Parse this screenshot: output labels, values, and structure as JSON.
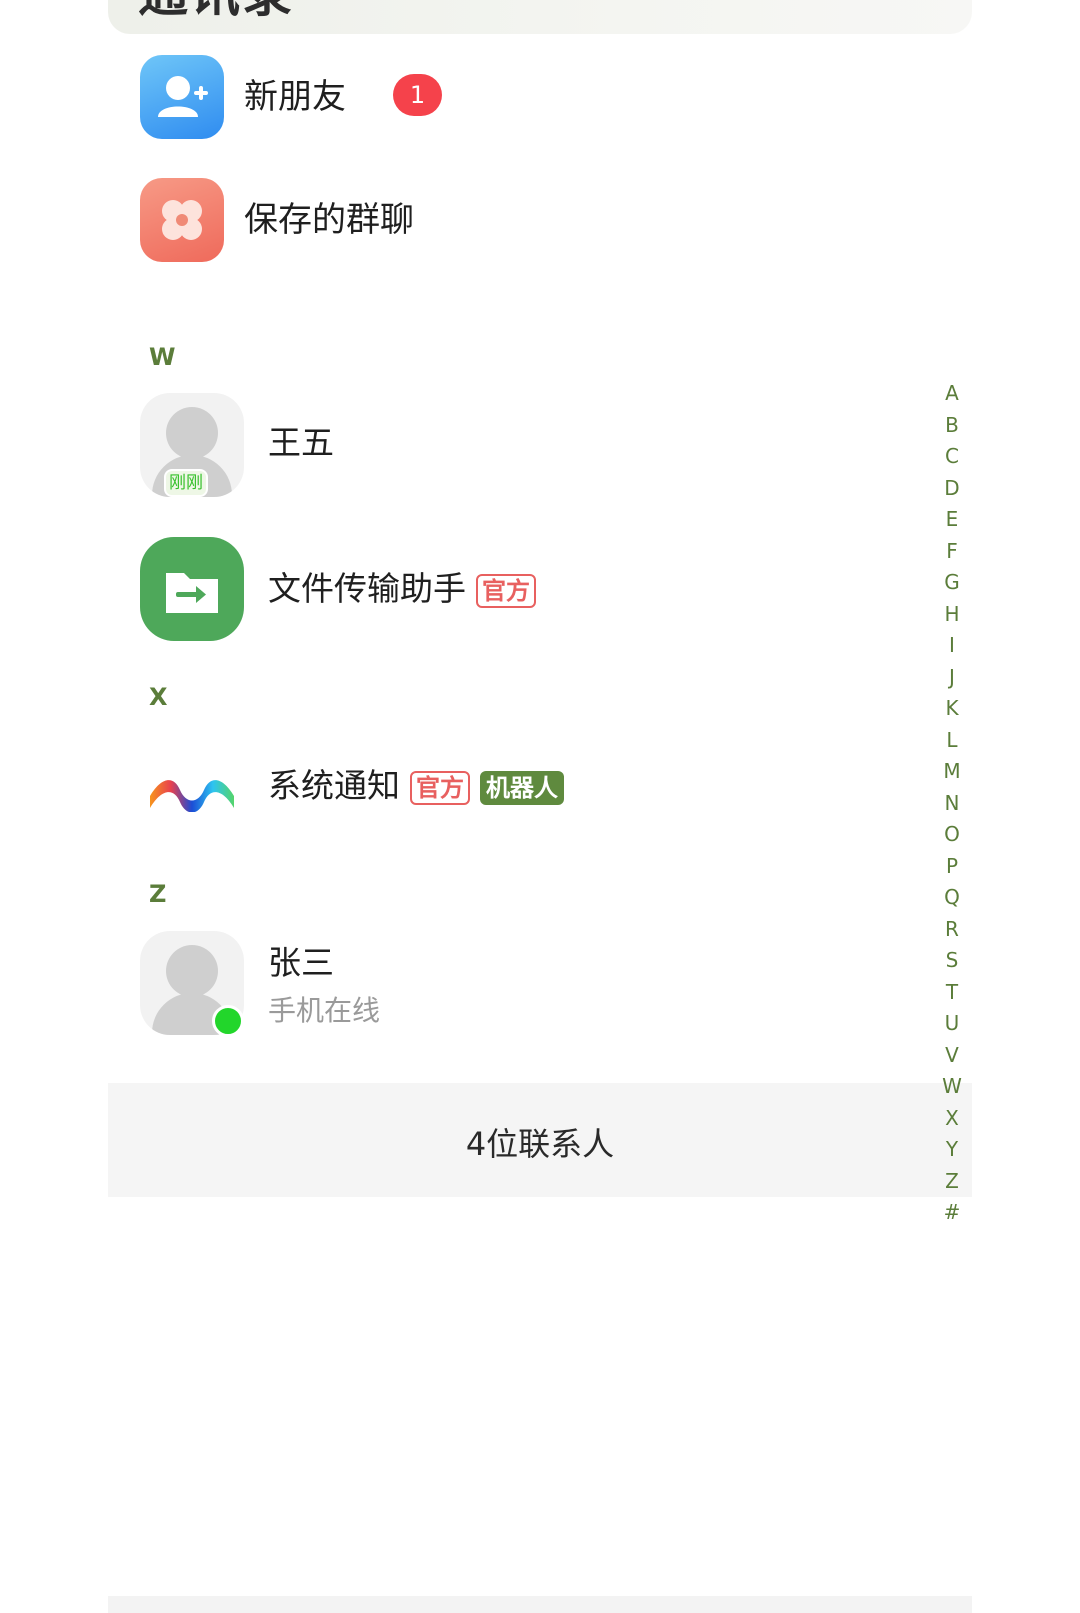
{
  "header": {
    "title": "通讯录"
  },
  "entries": [
    {
      "label": "新朋友",
      "badge": "1",
      "icon": "add-person-icon"
    },
    {
      "label": "保存的群聊",
      "icon": "clover-icon"
    }
  ],
  "sections": [
    {
      "letter": "W",
      "contacts": [
        {
          "name": "王五",
          "presence": "刚刚"
        },
        {
          "name": "文件传输助手",
          "tag": "官方"
        }
      ]
    },
    {
      "letter": "X",
      "contacts": [
        {
          "name": "系统通知",
          "tag": "官方",
          "tag2": "机器人"
        }
      ]
    },
    {
      "letter": "Z",
      "contacts": [
        {
          "name": "张三",
          "status": "手机在线"
        }
      ]
    }
  ],
  "footer": {
    "count_text": "4位联系人"
  },
  "alphabet": [
    "A",
    "B",
    "C",
    "D",
    "E",
    "F",
    "G",
    "H",
    "I",
    "J",
    "K",
    "L",
    "M",
    "N",
    "O",
    "P",
    "Q",
    "R",
    "S",
    "T",
    "U",
    "V",
    "W",
    "X",
    "Y",
    "Z",
    "#"
  ],
  "colors": {
    "accent": "#5b7d3a",
    "badge_red": "#f5424b",
    "official_tag": "#e8605f",
    "bot_tag": "#5f8a3e",
    "online": "#22d62b"
  }
}
